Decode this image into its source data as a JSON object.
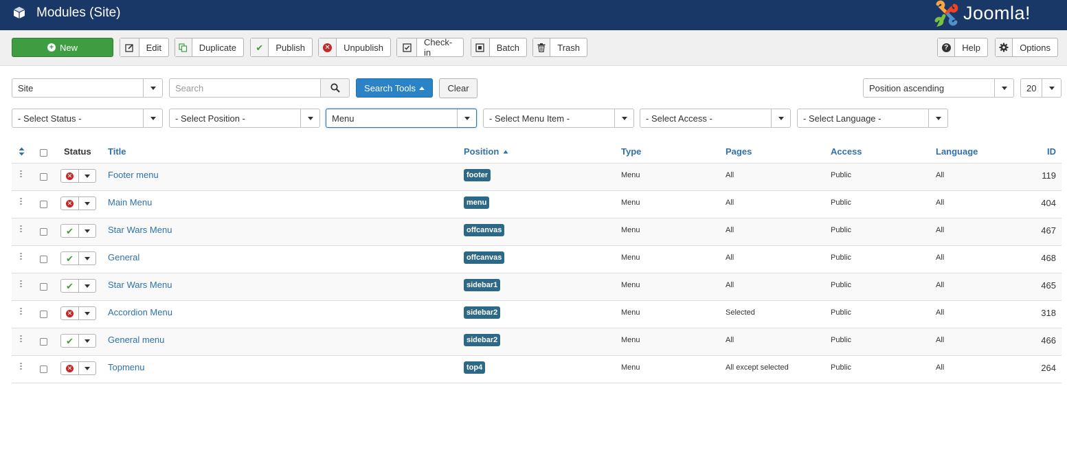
{
  "header": {
    "title": "Modules (Site)",
    "brand": "Joomla!",
    "bg_color": "#1a3867"
  },
  "toolbar": {
    "new_label": "New",
    "edit_label": "Edit",
    "duplicate_label": "Duplicate",
    "publish_label": "Publish",
    "unpublish_label": "Unpublish",
    "checkin_label": "Check-in",
    "batch_label": "Batch",
    "trash_label": "Trash",
    "help_label": "Help",
    "options_label": "Options"
  },
  "filters": {
    "client": "Site",
    "search_placeholder": "Search",
    "search_tools_label": "Search Tools",
    "clear_label": "Clear",
    "ordering": "Position ascending",
    "limit": "20",
    "status": "- Select Status -",
    "position": "- Select Position -",
    "module": "Menu",
    "menu_item": "- Select Menu Item -",
    "access": "- Select Access -",
    "language": "- Select Language -"
  },
  "table": {
    "headers": {
      "status": "Status",
      "title": "Title",
      "position": "Position",
      "type": "Type",
      "pages": "Pages",
      "access": "Access",
      "language": "Language",
      "id": "ID"
    },
    "rows": [
      {
        "published": false,
        "title": "Footer menu",
        "position": "footer",
        "type": "Menu",
        "pages": "All",
        "access": "Public",
        "language": "All",
        "id": "119"
      },
      {
        "published": false,
        "title": "Main Menu",
        "position": "menu",
        "type": "Menu",
        "pages": "All",
        "access": "Public",
        "language": "All",
        "id": "404"
      },
      {
        "published": true,
        "title": "Star Wars Menu",
        "position": "offcanvas",
        "type": "Menu",
        "pages": "All",
        "access": "Public",
        "language": "All",
        "id": "467"
      },
      {
        "published": true,
        "title": "General",
        "position": "offcanvas",
        "type": "Menu",
        "pages": "All",
        "access": "Public",
        "language": "All",
        "id": "468"
      },
      {
        "published": true,
        "title": "Star Wars Menu",
        "position": "sidebar1",
        "type": "Menu",
        "pages": "All",
        "access": "Public",
        "language": "All",
        "id": "465"
      },
      {
        "published": false,
        "title": "Accordion Menu",
        "position": "sidebar2",
        "type": "Menu",
        "pages": "Selected",
        "access": "Public",
        "language": "All",
        "id": "318"
      },
      {
        "published": true,
        "title": "General menu",
        "position": "sidebar2",
        "type": "Menu",
        "pages": "All",
        "access": "Public",
        "language": "All",
        "id": "466"
      },
      {
        "published": false,
        "title": "Topmenu",
        "position": "top4",
        "type": "Menu",
        "pages": "All except selected",
        "access": "Public",
        "language": "All",
        "id": "264"
      }
    ]
  }
}
